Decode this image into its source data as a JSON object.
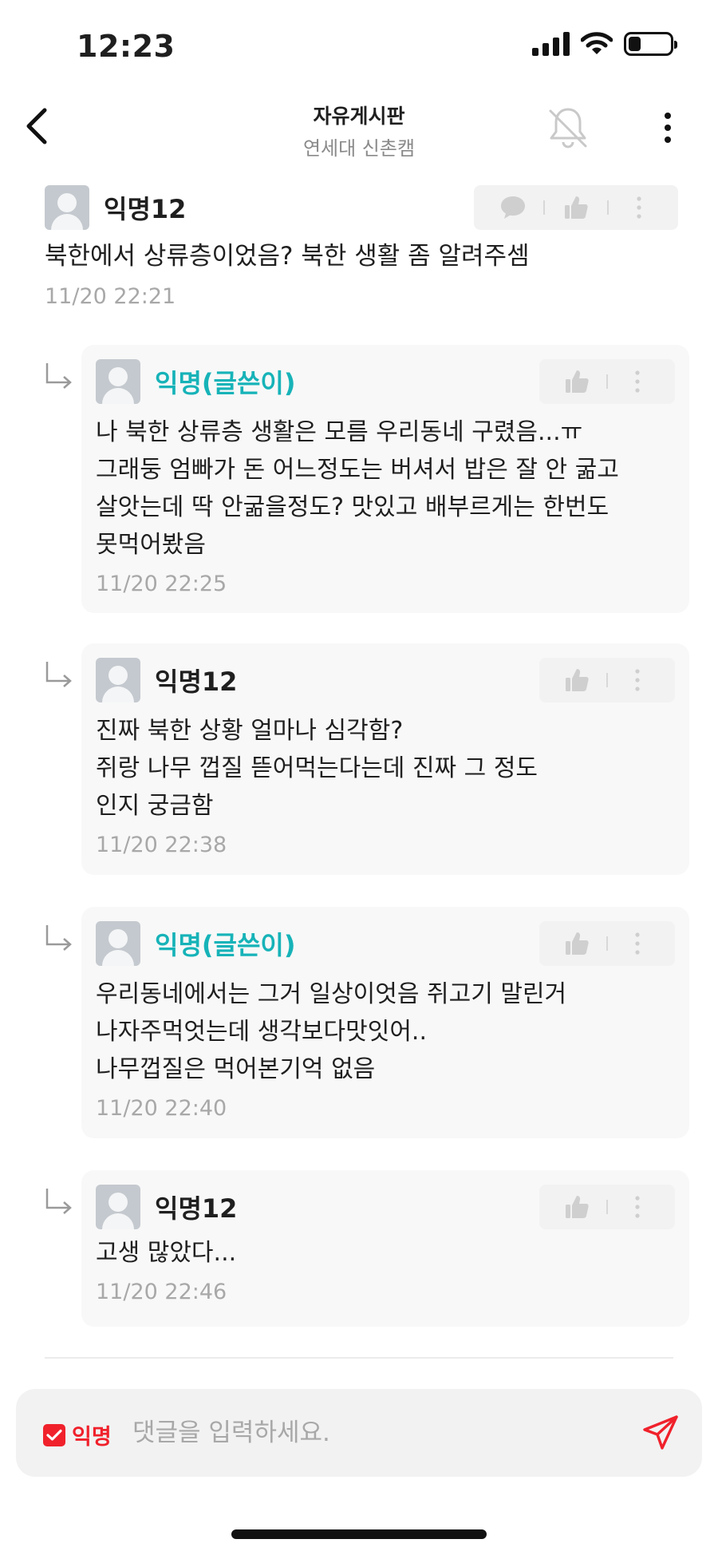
{
  "status_bar": {
    "time": "12:23"
  },
  "header": {
    "title": "자유게시판",
    "subtitle": "연세대 신촌캠"
  },
  "main_comment": {
    "author": "익명12",
    "text": "북한에서 상류층이었음? 북한 생활 좀 알려주셈",
    "time": "11/20 22:21"
  },
  "replies": [
    {
      "author": "익명(글쓴이)",
      "is_op": true,
      "text": "나 북한 상류층 생활은 모름 우리동네 구렸음...ㅠ\n그래둥 엄빠가 돈 어느정도는 버셔서 밥은 잘 안 굶고\n살앗는데 딱 안굶을정도? 맛있고 배부르게는 한번도\n못먹어봤음",
      "time": "11/20 22:25"
    },
    {
      "author": "익명12",
      "is_op": false,
      "text": "진짜 북한 상황 얼마나 심각함?\n쥐랑 나무 껍질 뜯어먹는다는데 진짜 그 정도\n인지 궁금함",
      "time": "11/20 22:38"
    },
    {
      "author": "익명(글쓴이)",
      "is_op": true,
      "text": "우리동네에서는 그거 일상이엇음 쥐고기 말린거\n나자주먹엇는데 생각보다맛잇어..\n나무껍질은 먹어본기억 없음",
      "time": "11/20 22:40"
    },
    {
      "author": "익명12",
      "is_op": false,
      "text": "고생 많았다...",
      "time": "11/20 22:46"
    }
  ],
  "input_bar": {
    "anonymous_label": "익명",
    "anonymous_checked": true,
    "placeholder": "댓글을 입력하세요."
  },
  "colors": {
    "op_author": "#16b3b8",
    "accent_red": "#f0212b",
    "timestamp": "#a8a8a8",
    "reply_bg": "#f8f8f8",
    "icon_gray": "#c9c9c9"
  },
  "icons": {
    "back": "chevron-left-icon",
    "notification": "bell-off-icon",
    "more": "more-vertical-icon",
    "reply_marker": "reply-arrow-icon",
    "comment": "speech-bubble-icon",
    "like": "thumbs-up-icon",
    "send": "send-icon",
    "checkbox": "checkmark-icon"
  }
}
